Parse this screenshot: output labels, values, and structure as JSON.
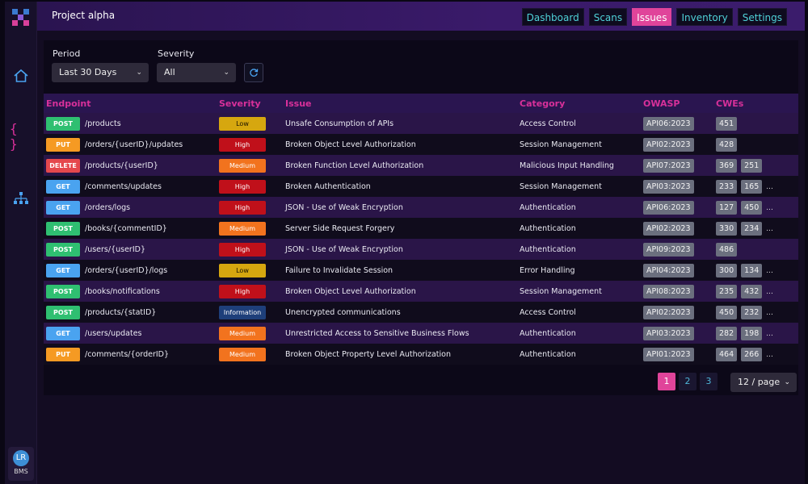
{
  "header": {
    "project_title": "Project alpha",
    "nav": [
      "Dashboard",
      "Scans",
      "Issues",
      "Inventory",
      "Settings"
    ],
    "active_nav": "Issues"
  },
  "sidebar": {
    "icons": [
      "home-icon",
      "braces-icon",
      "sitemap-icon"
    ],
    "user": {
      "initials": "LR",
      "label": "BMS"
    }
  },
  "filters": {
    "period_label": "Period",
    "period_value": "Last 30 Days",
    "severity_label": "Severity",
    "severity_value": "All"
  },
  "table": {
    "columns": [
      "Endpoint",
      "Severity",
      "Issue",
      "Category",
      "OWASP",
      "CWEs"
    ],
    "rows": [
      {
        "method": "POST",
        "endpoint": "/products",
        "severity": "Low",
        "issue": "Unsafe Consumption of APIs",
        "category": "Access Control",
        "owasp": "API06:2023",
        "cwes": [
          "451"
        ],
        "more": ""
      },
      {
        "method": "PUT",
        "endpoint": "/orders/{userID}/updates",
        "severity": "High",
        "issue": "Broken Object Level Authorization",
        "category": "Session Management",
        "owasp": "API02:2023",
        "cwes": [
          "428"
        ],
        "more": ""
      },
      {
        "method": "DELETE",
        "endpoint": "/products/{userID}",
        "severity": "Medium",
        "issue": "Broken Function Level Authorization",
        "category": "Malicious Input Handling",
        "owasp": "API07:2023",
        "cwes": [
          "369",
          "251"
        ],
        "more": ""
      },
      {
        "method": "GET",
        "endpoint": "/comments/updates",
        "severity": "High",
        "issue": "Broken Authentication",
        "category": "Session Management",
        "owasp": "API03:2023",
        "cwes": [
          "233",
          "165"
        ],
        "more": "..."
      },
      {
        "method": "GET",
        "endpoint": "/orders/logs",
        "severity": "High",
        "issue": "JSON - Use of Weak Encryption",
        "category": "Authentication",
        "owasp": "API06:2023",
        "cwes": [
          "127",
          "450"
        ],
        "more": "..."
      },
      {
        "method": "POST",
        "endpoint": "/books/{commentID}",
        "severity": "Medium",
        "issue": "Server Side Request Forgery",
        "category": "Authentication",
        "owasp": "API02:2023",
        "cwes": [
          "330",
          "234"
        ],
        "more": "..."
      },
      {
        "method": "POST",
        "endpoint": "/users/{userID}",
        "severity": "High",
        "issue": "JSON - Use of Weak Encryption",
        "category": "Authentication",
        "owasp": "API09:2023",
        "cwes": [
          "486"
        ],
        "more": ""
      },
      {
        "method": "GET",
        "endpoint": "/orders/{userID}/logs",
        "severity": "Low",
        "issue": "Failure to Invalidate Session",
        "category": "Error Handling",
        "owasp": "API04:2023",
        "cwes": [
          "300",
          "134"
        ],
        "more": "..."
      },
      {
        "method": "POST",
        "endpoint": "/books/notifications",
        "severity": "High",
        "issue": "Broken Object Level Authorization",
        "category": "Session Management",
        "owasp": "API08:2023",
        "cwes": [
          "235",
          "432"
        ],
        "more": "..."
      },
      {
        "method": "POST",
        "endpoint": "/products/{statID}",
        "severity": "Information",
        "issue": "Unencrypted communications",
        "category": "Access Control",
        "owasp": "API02:2023",
        "cwes": [
          "450",
          "232"
        ],
        "more": "..."
      },
      {
        "method": "GET",
        "endpoint": "/users/updates",
        "severity": "Medium",
        "issue": "Unrestricted Access to Sensitive Business Flows",
        "category": "Authentication",
        "owasp": "API03:2023",
        "cwes": [
          "282",
          "198"
        ],
        "more": "..."
      },
      {
        "method": "PUT",
        "endpoint": "/comments/{orderID}",
        "severity": "Medium",
        "issue": "Broken Object Property Level Authorization",
        "category": "Authentication",
        "owasp": "API01:2023",
        "cwes": [
          "464",
          "266"
        ],
        "more": "..."
      }
    ]
  },
  "pagination": {
    "pages": [
      "1",
      "2",
      "3"
    ],
    "active_page": "1",
    "per_page": "12 / page"
  },
  "colors": {
    "accent": "#e0449a",
    "nav_text": "#4fd2d8",
    "method": {
      "POST": "#2fbf71",
      "PUT": "#f59a23",
      "DELETE": "#e5484d",
      "GET": "#4aa3f0"
    },
    "severity": {
      "Low": "#d6a70f",
      "High": "#c0101a",
      "Medium": "#f2731e",
      "Information": "#1e3f7a"
    }
  }
}
